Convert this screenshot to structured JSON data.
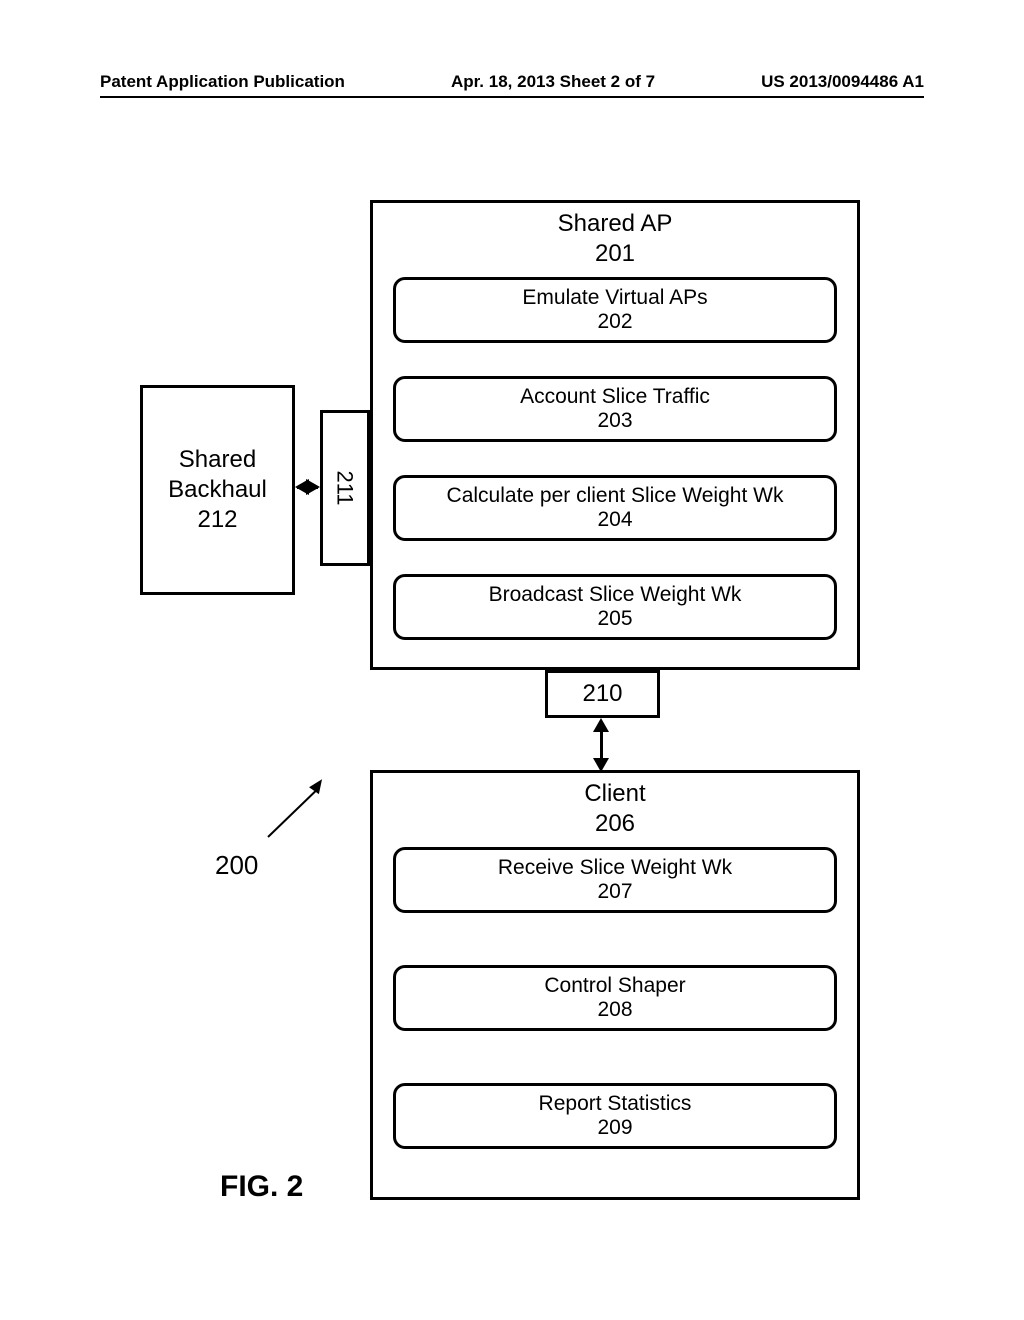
{
  "header": {
    "left": "Patent Application Publication",
    "center": "Apr. 18, 2013  Sheet 2 of 7",
    "right": "US 2013/0094486 A1"
  },
  "figure_label": "FIG. 2",
  "ref_200": "200",
  "backhaul": {
    "line1": "Shared",
    "line2": "Backhaul",
    "num": "212"
  },
  "port211": "211",
  "port210": "210",
  "shared_ap": {
    "title": "Shared AP",
    "num": "201",
    "items": [
      {
        "label": "Emulate Virtual APs",
        "num": "202"
      },
      {
        "label": "Account Slice Traffic",
        "num": "203"
      },
      {
        "label": "Calculate per client Slice Weight Wk",
        "num": "204"
      },
      {
        "label": "Broadcast Slice Weight Wk",
        "num": "205"
      }
    ]
  },
  "client": {
    "title": "Client",
    "num": "206",
    "items": [
      {
        "label": "Receive Slice Weight Wk",
        "num": "207"
      },
      {
        "label": "Control Shaper",
        "num": "208"
      },
      {
        "label": "Report Statistics",
        "num": "209"
      }
    ]
  }
}
